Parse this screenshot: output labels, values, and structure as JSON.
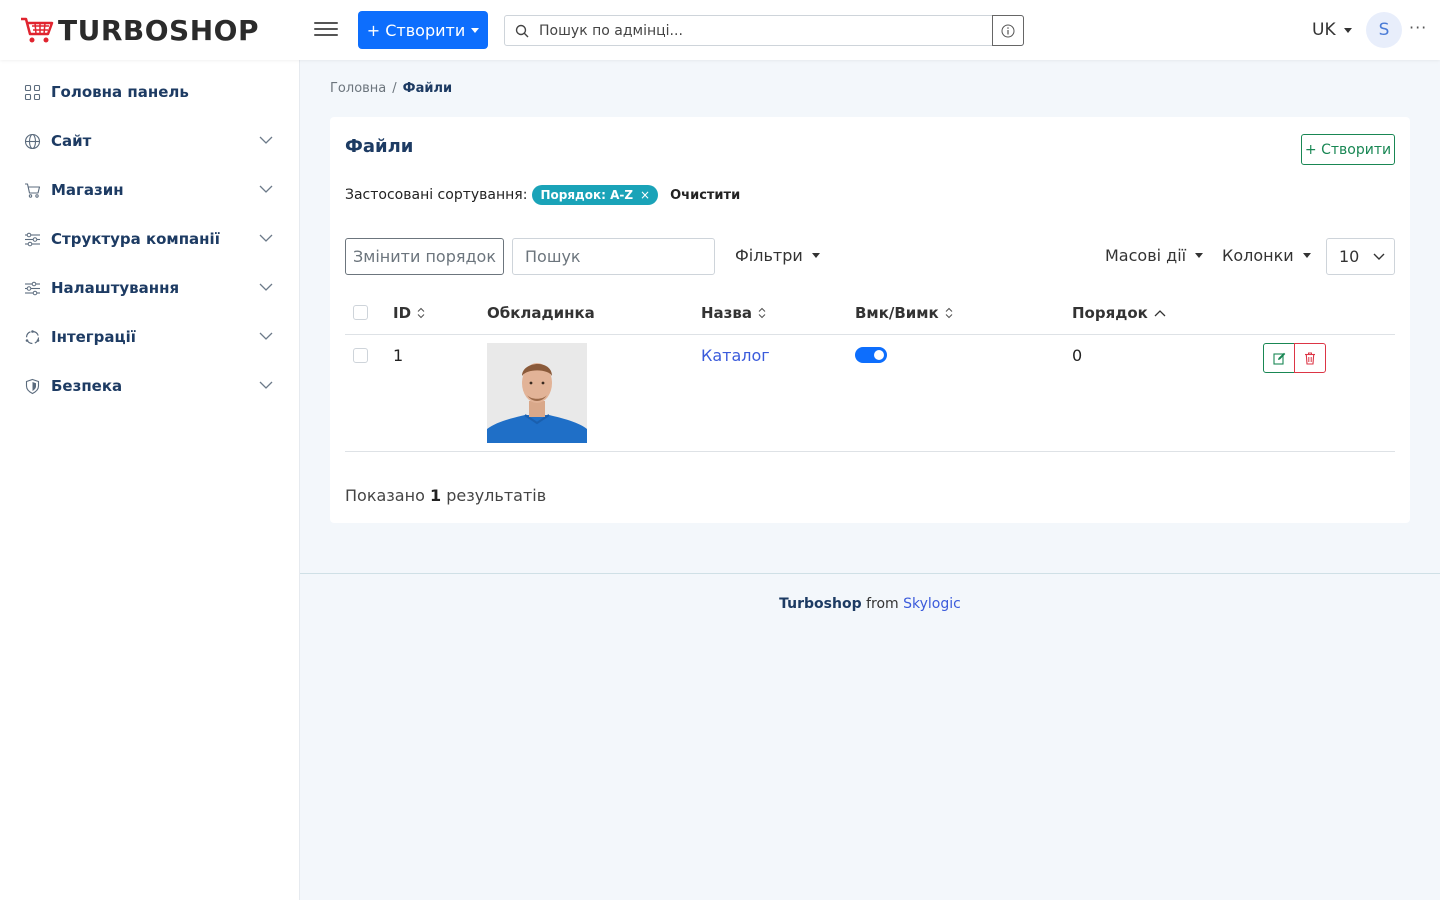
{
  "header": {
    "logo_text": "TURBOSHOP",
    "create_label": "+ Створити",
    "search_placeholder": "Пошук по адмінці...",
    "language": "UK",
    "avatar_initial": "S",
    "more": "···"
  },
  "sidebar": {
    "items": [
      {
        "label": "Головна панель",
        "icon": "dashboard-icon",
        "has_children": false
      },
      {
        "label": "Сайт",
        "icon": "globe-icon",
        "has_children": true
      },
      {
        "label": "Магазин",
        "icon": "cart-icon",
        "has_children": true
      },
      {
        "label": "Структура компанії",
        "icon": "sliders-icon",
        "has_children": true
      },
      {
        "label": "Налаштування",
        "icon": "settings-sliders-icon",
        "has_children": true
      },
      {
        "label": "Інтеграції",
        "icon": "integrations-icon",
        "has_children": true
      },
      {
        "label": "Безпека",
        "icon": "shield-icon",
        "has_children": true
      }
    ]
  },
  "breadcrumb": {
    "home": "Головна",
    "separator": "/",
    "current": "Файли"
  },
  "card": {
    "title": "Файли",
    "create_label": "+ Створити",
    "sorting_label": "Застосовані сортування:",
    "sorting_chip": "Порядок: A-Z",
    "chip_close": "×",
    "clear_label": "Очистити",
    "reorder_label": "Змінити порядок",
    "search_placeholder": "Пошук",
    "filters_label": "Фільтри",
    "bulk_label": "Масові дії",
    "columns_label": "Колонки",
    "page_size": "10"
  },
  "table": {
    "columns": [
      "ID",
      "Обкладинка",
      "Назва",
      "Вмк/Вимк",
      "Порядок"
    ],
    "rows": [
      {
        "id": "1",
        "name": "Каталог",
        "enabled": true,
        "order": "0"
      }
    ]
  },
  "results": {
    "prefix": "Показано",
    "count": "1",
    "suffix": "результатів"
  },
  "footer": {
    "brand": "Turboshop",
    "from": "from",
    "company": "Skylogic"
  },
  "colors": {
    "primary": "#0d6efd",
    "success": "#198754",
    "danger": "#dc3545",
    "chip": "#1aa3b8",
    "navy": "#1d3b63"
  }
}
